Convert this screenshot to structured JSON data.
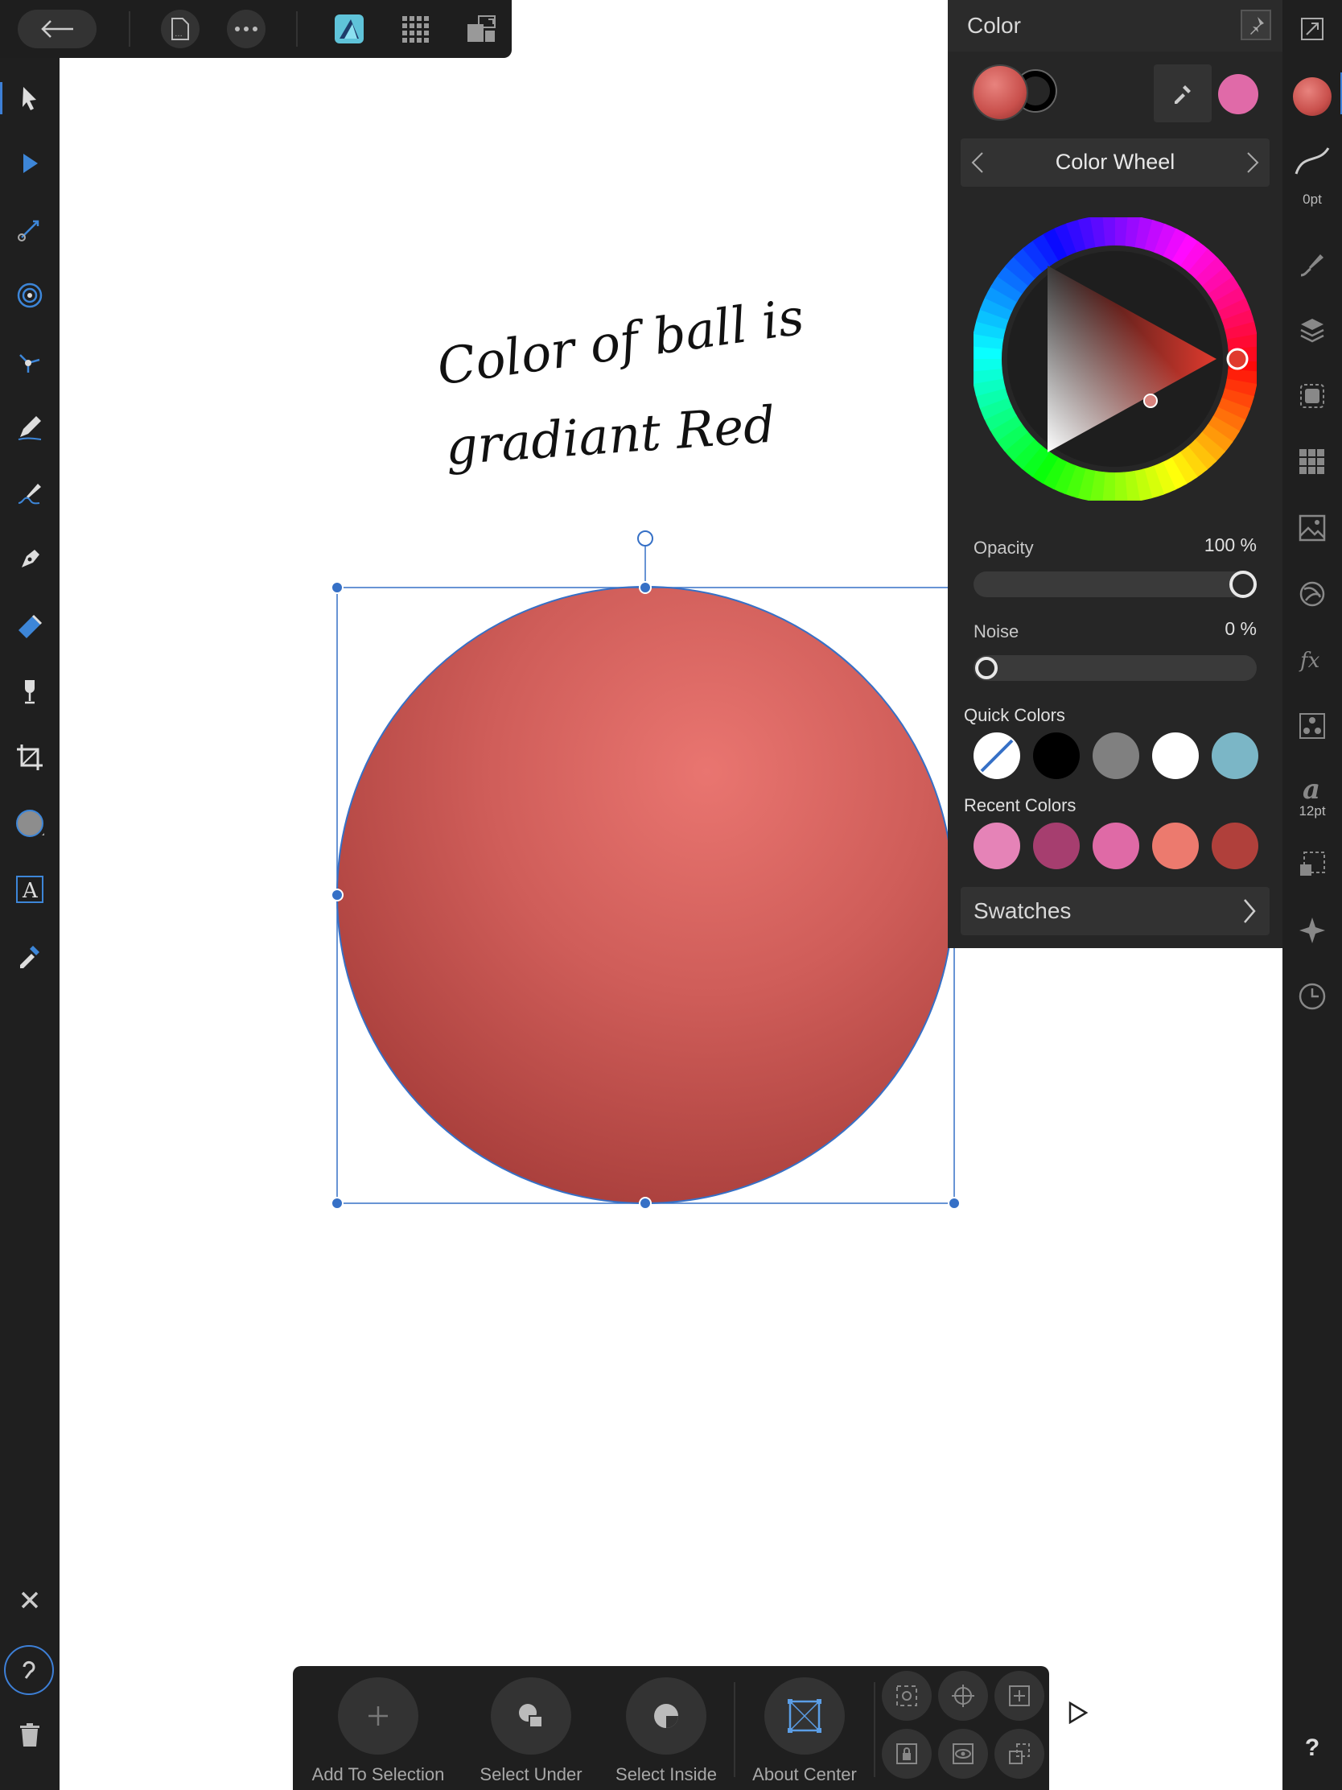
{
  "top_toolbar": {
    "back_icon": "arrow-left-icon",
    "document_icon": "document-icon",
    "more_icon": "ellipsis-icon",
    "persona_icon": "designer-persona-icon",
    "grid_icon": "pixel-persona-icon",
    "export_icon": "export-persona-icon"
  },
  "left_tools": [
    {
      "name": "move-tool",
      "icon": "pointer-icon",
      "active": true
    },
    {
      "name": "node-tool",
      "icon": "node-pointer-icon"
    },
    {
      "name": "point-transform-tool",
      "icon": "point-transform-icon"
    },
    {
      "name": "corner-tool",
      "icon": "target-icon"
    },
    {
      "name": "contour-tool",
      "icon": "contour-icon"
    },
    {
      "name": "pencil-tool",
      "icon": "pencil-icon"
    },
    {
      "name": "vector-brush-tool",
      "icon": "brush-icon"
    },
    {
      "name": "pen-tool",
      "icon": "pen-nib-icon"
    },
    {
      "name": "fill-tool",
      "icon": "fill-icon"
    },
    {
      "name": "transparency-tool",
      "icon": "wine-glass-icon"
    },
    {
      "name": "crop-tool",
      "icon": "crop-icon"
    },
    {
      "name": "ellipse-tool",
      "icon": "ellipse-icon"
    },
    {
      "name": "text-tool",
      "icon": "text-icon"
    },
    {
      "name": "color-picker-tool",
      "icon": "eyedropper-icon"
    }
  ],
  "bottom_left": {
    "close_icon": "close-icon",
    "help_icon": "command-controller-icon",
    "trash_icon": "trash-icon"
  },
  "canvas": {
    "handwritten_line1": "Color of ball is",
    "handwritten_line2": "gradiant Red",
    "ball_colors": {
      "highlight": "#e97570",
      "mid": "#cf5d59",
      "shadow": "#a33a37"
    },
    "selection_color": "#3670c6"
  },
  "color_panel": {
    "title": "Color",
    "pin_icon": "pin-icon",
    "fill_color": "#c9504c",
    "stroke_color": "#000000",
    "picker_icon": "eyedropper-icon",
    "picked_color": "#e06aa8",
    "mode": "Color Wheel",
    "mode_prev_icon": "chevron-left-icon",
    "mode_next_icon": "chevron-right-icon",
    "hue_color": "#e03a2e",
    "opacity": {
      "label": "Opacity",
      "value": "100 %",
      "fraction": 1.0
    },
    "noise": {
      "label": "Noise",
      "value": "0 %",
      "fraction": 0.0
    },
    "quick_colors_label": "Quick Colors",
    "quick_colors": [
      "none",
      "#000000",
      "#808080",
      "#ffffff",
      "#7bb6c6"
    ],
    "recent_colors_label": "Recent Colors",
    "recent_colors": [
      "#e583b7",
      "#a63e6f",
      "#df6aa6",
      "#ec7a6e",
      "#b0403b"
    ],
    "swatches_label": "Swatches",
    "swatches_icon": "chevron-right-icon"
  },
  "studio": {
    "stroke_width": "0pt",
    "font_size": "12pt",
    "help": "?",
    "icons": [
      "fullscreen-icon",
      "color-icon",
      "stroke-icon",
      "brush-icon",
      "layers-icon",
      "appearance-icon",
      "swatches-grid-icon",
      "image-icon",
      "transform-icon",
      "effects-icon",
      "styles-icon",
      "typography-icon",
      "symbols-icon",
      "navigator-icon",
      "history-icon"
    ]
  },
  "context_toolbar": {
    "add_to_selection": "Add To Selection",
    "select_under": "Select Under",
    "select_inside": "Select Inside",
    "about_center": "About Center",
    "expand_icon": "play-icon"
  }
}
